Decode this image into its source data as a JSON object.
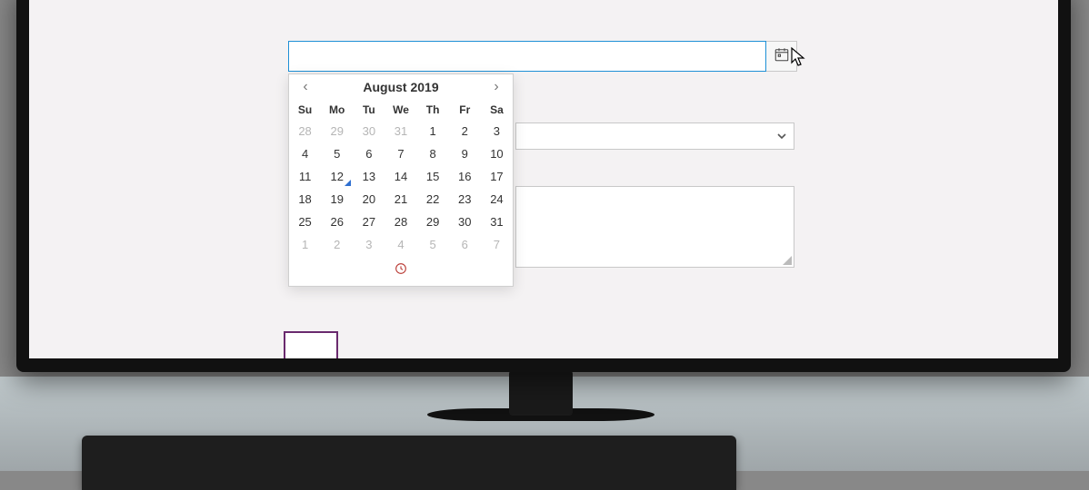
{
  "date_input": {
    "value": "",
    "placeholder": ""
  },
  "dropdown": {
    "selected": ""
  },
  "textarea": {
    "value": ""
  },
  "calendar": {
    "title": "August 2019",
    "weekdays": [
      "Su",
      "Mo",
      "Tu",
      "We",
      "Th",
      "Fr",
      "Sa"
    ],
    "today_index": 15,
    "weeks": [
      {
        "days": [
          {
            "n": 28,
            "other": true
          },
          {
            "n": 29,
            "other": true
          },
          {
            "n": 30,
            "other": true
          },
          {
            "n": 31,
            "other": true
          },
          {
            "n": 1
          },
          {
            "n": 2
          },
          {
            "n": 3
          }
        ]
      },
      {
        "days": [
          {
            "n": 4
          },
          {
            "n": 5
          },
          {
            "n": 6
          },
          {
            "n": 7
          },
          {
            "n": 8
          },
          {
            "n": 9
          },
          {
            "n": 10
          }
        ]
      },
      {
        "days": [
          {
            "n": 11
          },
          {
            "n": 12,
            "today": true
          },
          {
            "n": 13
          },
          {
            "n": 14
          },
          {
            "n": 15
          },
          {
            "n": 16
          },
          {
            "n": 17
          }
        ]
      },
      {
        "days": [
          {
            "n": 18
          },
          {
            "n": 19
          },
          {
            "n": 20
          },
          {
            "n": 21
          },
          {
            "n": 22
          },
          {
            "n": 23
          },
          {
            "n": 24
          }
        ]
      },
      {
        "days": [
          {
            "n": 25
          },
          {
            "n": 26
          },
          {
            "n": 27
          },
          {
            "n": 28
          },
          {
            "n": 29
          },
          {
            "n": 30
          },
          {
            "n": 31
          }
        ]
      },
      {
        "days": [
          {
            "n": 1,
            "other": true
          },
          {
            "n": 2,
            "other": true
          },
          {
            "n": 3,
            "other": true
          },
          {
            "n": 4,
            "other": true
          },
          {
            "n": 5,
            "other": true
          },
          {
            "n": 6,
            "other": true
          },
          {
            "n": 7,
            "other": true
          }
        ]
      }
    ]
  }
}
